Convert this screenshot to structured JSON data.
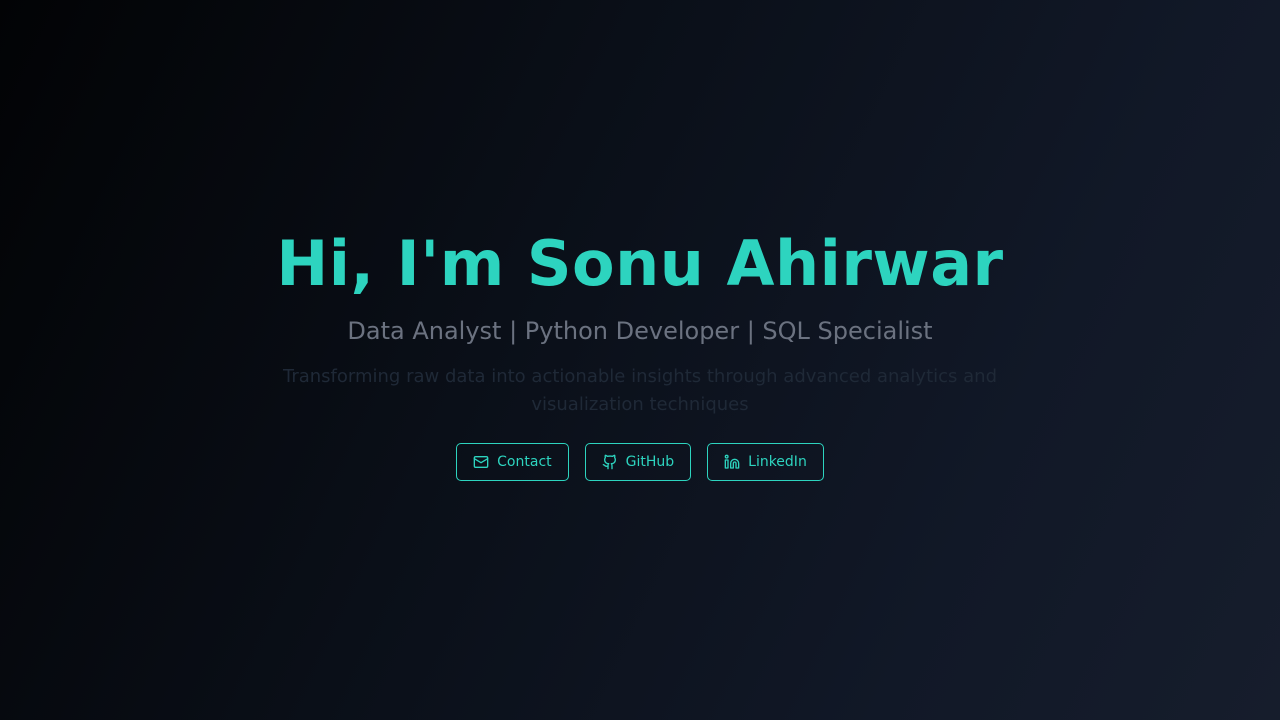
{
  "hero": {
    "title": "Hi, I'm Sonu Ahirwar",
    "subtitle": "Data Analyst | Python Developer | SQL Specialist",
    "description": "Transforming raw data into actionable insights through advanced analytics and visualization techniques"
  },
  "buttons": [
    {
      "label": "Contact",
      "icon": "mail-icon"
    },
    {
      "label": "GitHub",
      "icon": "github-icon"
    },
    {
      "label": "LinkedIn",
      "icon": "linkedin-icon"
    }
  ],
  "colors": {
    "accent": "#2dd4bf",
    "subtitle": "#6b7280",
    "description": "#1f2937",
    "background_start": "#020305",
    "background_end": "#161d2c"
  }
}
